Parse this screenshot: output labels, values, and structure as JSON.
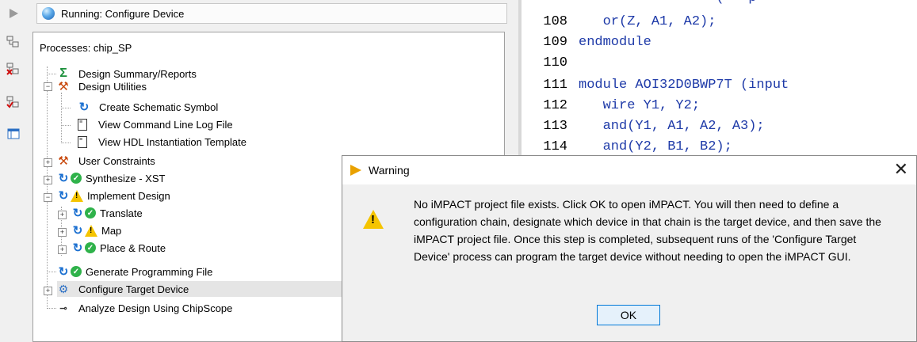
{
  "status": {
    "text": "Running: Configure Device"
  },
  "processes": {
    "title": "Processes: chip_SP",
    "items": [
      {
        "label": "Design Summary/Reports"
      },
      {
        "label": "Design Utilities"
      },
      {
        "label": "Create Schematic Symbol"
      },
      {
        "label": "View Command Line Log File"
      },
      {
        "label": "View HDL Instantiation Template"
      },
      {
        "label": "User Constraints"
      },
      {
        "label": "Synthesize - XST"
      },
      {
        "label": "Implement Design"
      },
      {
        "label": "Translate"
      },
      {
        "label": "Map"
      },
      {
        "label": "Place & Route"
      },
      {
        "label": "Generate Programming File"
      },
      {
        "label": "Configure Target Device"
      },
      {
        "label": "Analyze Design Using ChipScope"
      }
    ]
  },
  "code": {
    "lines": [
      {
        "num": "108",
        "text": "   or(Z, A1, A2);"
      },
      {
        "num": "109",
        "text": "endmodule"
      },
      {
        "num": "110",
        "text": ""
      },
      {
        "num": "111",
        "text": "module AOI32D0BWP7T (input"
      },
      {
        "num": "112",
        "text": "   wire Y1, Y2;"
      },
      {
        "num": "113",
        "text": "   and(Y1, A1, A2, A3);"
      },
      {
        "num": "114",
        "text": "   and(Y2, B1, B2);"
      }
    ]
  },
  "dialog": {
    "title": "Warning",
    "message": "No iMPACT project file exists. Click OK to open iMPACT. You will then need to define a configuration chain, designate which device in that chain is the target device, and then save the iMPACT project file. Once this step is completed, subsequent runs of the 'Configure Target Device' process can program the target device without needing to open the iMPACT GUI.",
    "ok_label": "OK",
    "close_label": "✕"
  },
  "icons": {
    "toolbar": [
      "run-icon",
      "process-properties-icon",
      "cleanup-icon",
      "rerun-icon",
      "table-icon"
    ],
    "brand_color": "#e9a100",
    "warn_color": "#f5c400",
    "ok_color": "#2fb24a"
  }
}
